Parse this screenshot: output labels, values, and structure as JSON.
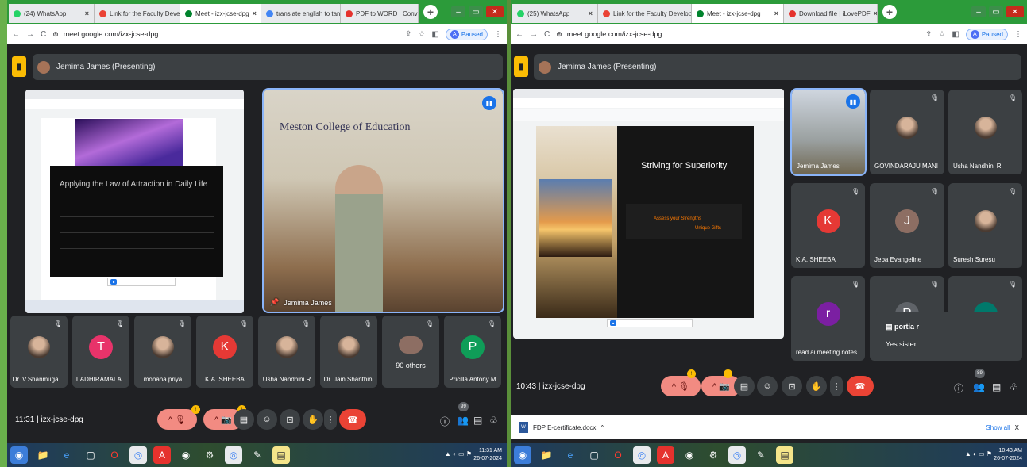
{
  "left": {
    "tabs": [
      {
        "label": "(24) WhatsApp",
        "color": "#25d366"
      },
      {
        "label": "Link for the Faculty Developm",
        "color": "#ea4335"
      },
      {
        "label": "Meet - izx-jcse-dpg",
        "color": "#00832d"
      },
      {
        "label": "translate english to tamil - Go",
        "color": "#4285f4"
      },
      {
        "label": "PDF to WORD | Convert PDF",
        "color": "#e5322d"
      }
    ],
    "url": "meet.google.com/izx-jcse-dpg",
    "paused": "Paused",
    "presenter": "Jemima James (Presenting)",
    "slide_title": "Applying the Law of Attraction in Daily Life",
    "speaker_name": "Jemima James",
    "college_sign": "Meston College of Education",
    "participants": [
      {
        "name": "Dr. V.Shanmuga ...",
        "kind": "photo"
      },
      {
        "name": "T.ADHIRAMALA...",
        "kind": "letter",
        "letter": "T",
        "color": "#e8336a"
      },
      {
        "name": "mohana priya",
        "kind": "photo"
      },
      {
        "name": "K.A. SHEEBA",
        "kind": "letter",
        "letter": "K",
        "color": "#e53935"
      },
      {
        "name": "Usha Nandhini R",
        "kind": "photo"
      },
      {
        "name": "Dr. Jain Shanthini",
        "kind": "photo"
      },
      {
        "name": "",
        "kind": "others",
        "others": "90 others"
      },
      {
        "name": "Pricilla Antony M",
        "kind": "letter",
        "letter": "P",
        "color": "#0f9d58"
      }
    ],
    "time": "11:31",
    "code": "izx-jcse-dpg",
    "people_count": "99",
    "clock_time": "11:31 AM",
    "clock_date": "26-07-2024"
  },
  "right": {
    "tabs": [
      {
        "label": "(25) WhatsApp",
        "color": "#25d366"
      },
      {
        "label": "Link for the Faculty Developme",
        "color": "#ea4335"
      },
      {
        "label": "Meet - izx-jcse-dpg",
        "color": "#00832d"
      },
      {
        "label": "Download file | iLovePDF",
        "color": "#e5322d"
      }
    ],
    "url": "meet.google.com/izx-jcse-dpg",
    "paused": "Paused",
    "presenter": "Jemima James (Presenting)",
    "slide_title": "Striving for Superiority",
    "slide_line1": "Assess your Strengths",
    "slide_line2": "Unique Gifts",
    "participants": [
      {
        "name": "Jemima James",
        "kind": "video"
      },
      {
        "name": "GOVINDARAJU MANI",
        "kind": "photo"
      },
      {
        "name": "Usha Nandhini R",
        "kind": "photo"
      },
      {
        "name": "K.A. SHEEBA",
        "kind": "letter",
        "letter": "K",
        "color": "#e53935"
      },
      {
        "name": "Jeba Evangeline",
        "kind": "letter",
        "letter": "J",
        "color": "#8d6e63"
      },
      {
        "name": "Suresh Suresu",
        "kind": "photo"
      },
      {
        "name": "read.ai meeting notes",
        "kind": "letter",
        "letter": "r",
        "color": "#7b1fa2"
      },
      {
        "name": "",
        "kind": "letter",
        "letter": "R",
        "color": "#5f6368"
      },
      {
        "name": "",
        "kind": "letter",
        "letter": "",
        "color": "#00796b"
      }
    ],
    "chat_sender": "portia r",
    "chat_message": "Yes sister.",
    "time": "10:43",
    "code": "izx-jcse-dpg",
    "people_count": "89",
    "download_file": "FDP E-certificate.docx",
    "show_all": "Show all",
    "clock_time": "10:43 AM",
    "clock_date": "26-07-2024"
  },
  "ui": {
    "separator": "|",
    "close_x": "X"
  }
}
